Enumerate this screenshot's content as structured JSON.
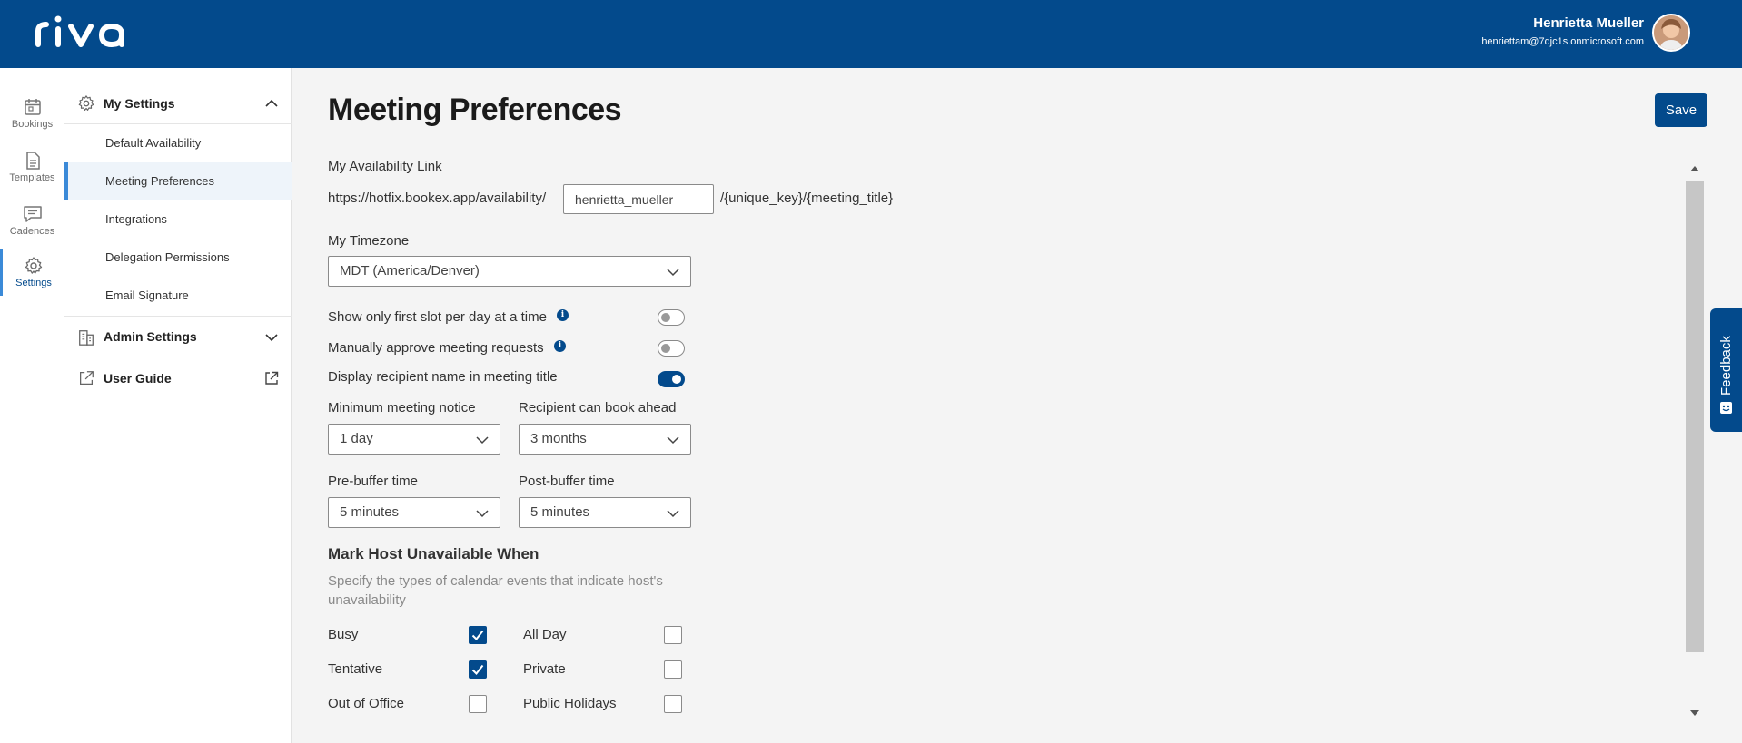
{
  "header": {
    "logo_text": "riva",
    "user_name": "Henrietta Mueller",
    "user_email": "henriettam@7djc1s.onmicrosoft.com"
  },
  "rail": {
    "items": [
      {
        "label": "Bookings",
        "icon": "calendar-icon"
      },
      {
        "label": "Templates",
        "icon": "document-icon"
      },
      {
        "label": "Cadences",
        "icon": "chat-icon"
      },
      {
        "label": "Settings",
        "icon": "gear-icon",
        "active": true
      }
    ]
  },
  "sidebar": {
    "my_settings": "My Settings",
    "items": [
      {
        "label": "Default Availability"
      },
      {
        "label": "Meeting Preferences",
        "active": true
      },
      {
        "label": "Integrations"
      },
      {
        "label": "Delegation Permissions"
      },
      {
        "label": "Email Signature"
      }
    ],
    "admin_settings": "Admin Settings",
    "user_guide": "User Guide"
  },
  "main": {
    "title": "Meeting Preferences",
    "save_label": "Save",
    "availability_link": {
      "label": "My Availability Link",
      "prefix": "https://hotfix.bookex.app/availability/",
      "value": "henrietta_mueller",
      "suffix": "/{unique_key}/{meeting_title}"
    },
    "timezone": {
      "label": "My Timezone",
      "value": "MDT (America/Denver)"
    },
    "toggles": [
      {
        "label": "Show only first slot per day at a time",
        "info": true,
        "on": false
      },
      {
        "label": "Manually approve meeting requests",
        "info": true,
        "on": false
      },
      {
        "label": "Display recipient name in meeting title",
        "info": false,
        "on": true
      }
    ],
    "min_notice": {
      "label": "Minimum meeting notice",
      "value": "1 day"
    },
    "book_ahead": {
      "label": "Recipient can book ahead",
      "value": "3 months"
    },
    "pre_buffer": {
      "label": "Pre-buffer time",
      "value": "5 minutes"
    },
    "post_buffer": {
      "label": "Post-buffer time",
      "value": "5 minutes"
    },
    "unavailable": {
      "title": "Mark Host Unavailable When",
      "description": "Specify the types of calendar events that indicate host's unavailability",
      "options": [
        {
          "label": "Busy",
          "checked": true
        },
        {
          "label": "All Day",
          "checked": false
        },
        {
          "label": "Tentative",
          "checked": true
        },
        {
          "label": "Private",
          "checked": false
        },
        {
          "label": "Out of Office",
          "checked": false
        },
        {
          "label": "Public Holidays",
          "checked": false
        }
      ]
    }
  },
  "feedback": {
    "label": "Feedback"
  },
  "colors": {
    "brand": "#034a8c",
    "accent": "#3b8ad8"
  }
}
